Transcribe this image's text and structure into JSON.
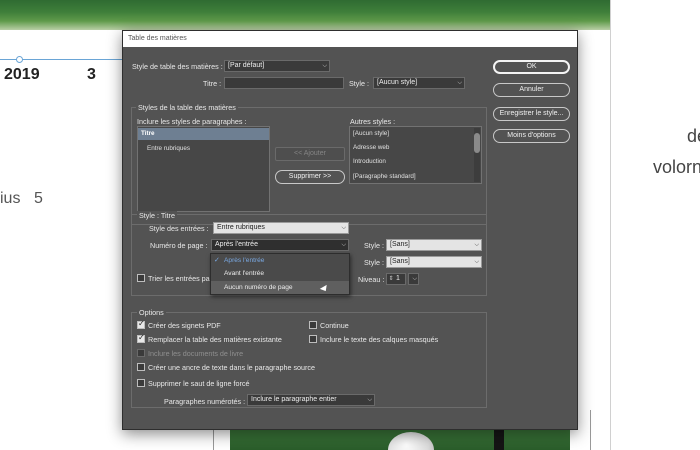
{
  "background": {
    "year": "2019",
    "number": "3",
    "left_fragment": "ius",
    "left_number": "5",
    "right_fragment_1": "de",
    "right_fragment_2": "volorn"
  },
  "dialog": {
    "title": "Table des matières",
    "toc_style_label": "Style de table des matières :",
    "toc_style_value": "[Par défaut]",
    "title_label": "Titre :",
    "title_value": "",
    "style_label": "Style :",
    "style_value": "[Aucun style]",
    "buttons": {
      "ok": "OK",
      "cancel": "Annuler",
      "save_style": "Enregistrer le style...",
      "fewer_options": "Moins d'options"
    },
    "paragraph_styles": {
      "group_label": "Styles de la table des matières",
      "include_label": "Inclure les styles de paragraphes :",
      "included": [
        "Titre",
        "Entre rubriques"
      ],
      "add_button": "<< Ajouter",
      "remove_button": "Supprimer >>",
      "other_label": "Autres styles :",
      "other_styles": [
        "[Aucun style]",
        "Adresse web",
        "Introduction",
        "[Paragraphe standard]"
      ]
    },
    "style_section": {
      "header": "Style : Titre",
      "entry_style_label": "Style des entrées :",
      "entry_style_value": "Entre rubriques",
      "page_number_label": "Numéro de page :",
      "page_number_value": "Après l'entrée",
      "style1_label": "Style :",
      "style1_value": "[Sans]",
      "style2_label": "Style :",
      "style2_value": "[Sans]",
      "sort_label": "Trier les entrées par",
      "level_label": "Niveau :",
      "level_value": "1"
    },
    "page_number_menu": {
      "options": [
        "Après l'entrée",
        "Avant l'entrée",
        "Aucun numéro de page"
      ],
      "selected": "Après l'entrée"
    },
    "options": {
      "header": "Options",
      "create_pdf_bookmarks": "Créer des signets PDF",
      "create_pdf_bookmarks_checked": true,
      "replace_existing": "Remplacer la table des matières existante",
      "replace_existing_checked": true,
      "include_book_docs": "Inclure les documents de livre",
      "include_book_docs_checked": false,
      "create_anchor": "Créer une ancre de texte dans le paragraphe source",
      "create_anchor_checked": false,
      "remove_line_break": "Supprimer le saut de ligne forcé",
      "remove_line_break_checked": false,
      "run_in": "Continue",
      "run_in_checked": false,
      "include_hidden_layers": "Inclure le texte des calques masqués",
      "include_hidden_layers_checked": false,
      "numbered_paragraphs_label": "Paragraphes numérotés :",
      "numbered_paragraphs_value": "Inclure le paragraphe entier"
    }
  }
}
